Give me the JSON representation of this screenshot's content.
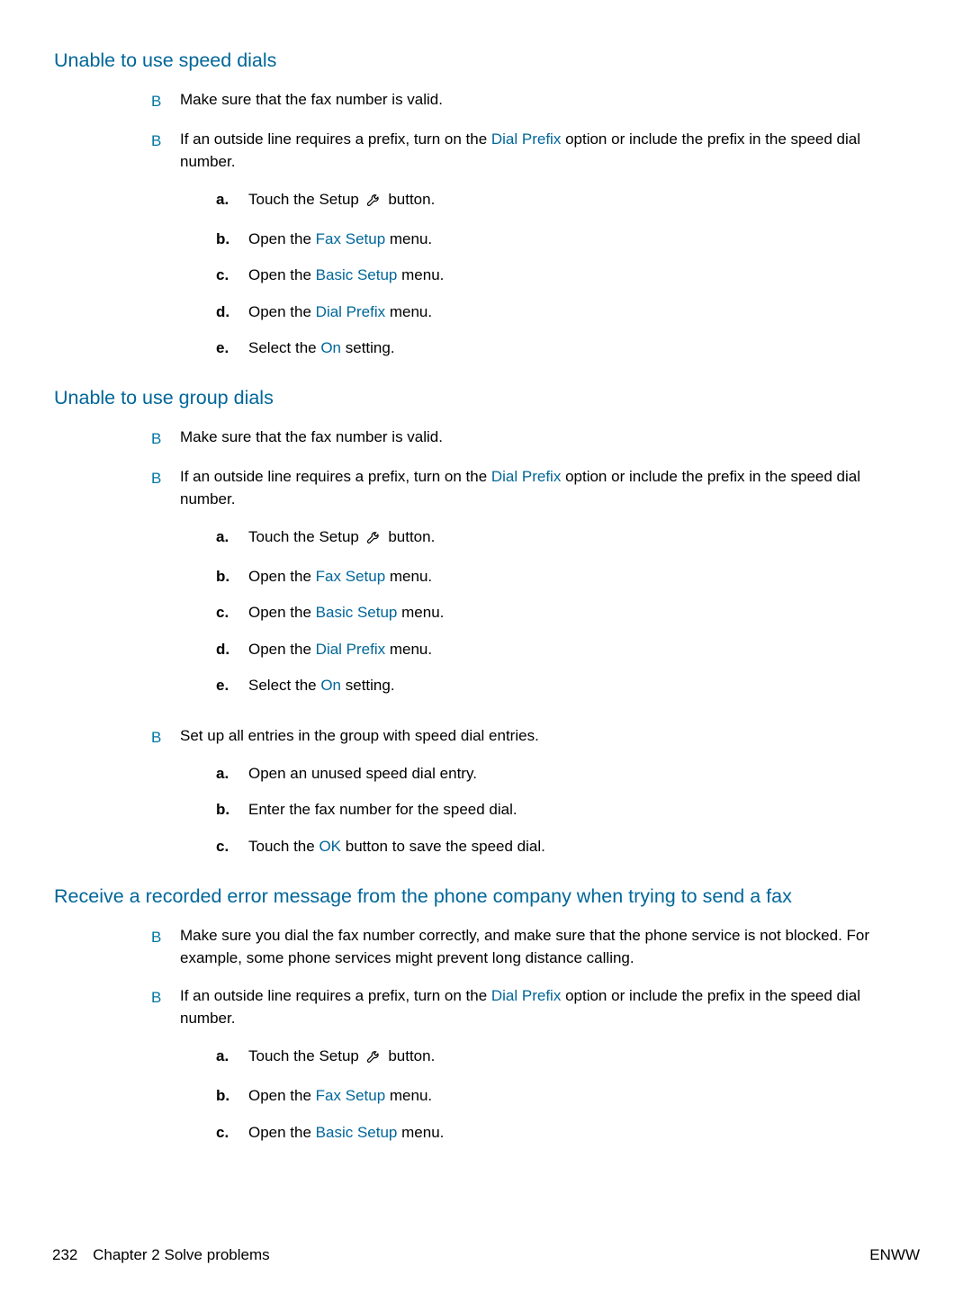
{
  "sections": [
    {
      "title": "Unable to use speed dials",
      "items": [
        {
          "parts": [
            {
              "t": "Make sure that the fax number is valid."
            }
          ]
        },
        {
          "parts": [
            {
              "t": "If an outside line requires a prefix, turn on the "
            },
            {
              "t": "Dial Prefix",
              "link": true
            },
            {
              "t": " option or include the prefix in the speed dial number."
            }
          ],
          "sub": [
            {
              "m": "a.",
              "parts": [
                {
                  "t": "Touch the Setup "
                },
                {
                  "icon": "wrench"
                },
                {
                  "t": " button."
                }
              ]
            },
            {
              "m": "b.",
              "parts": [
                {
                  "t": "Open the "
                },
                {
                  "t": "Fax Setup",
                  "link": true
                },
                {
                  "t": " menu."
                }
              ]
            },
            {
              "m": "c.",
              "parts": [
                {
                  "t": "Open the "
                },
                {
                  "t": "Basic Setup",
                  "link": true
                },
                {
                  "t": " menu."
                }
              ]
            },
            {
              "m": "d.",
              "parts": [
                {
                  "t": "Open the "
                },
                {
                  "t": "Dial Prefix",
                  "link": true
                },
                {
                  "t": " menu."
                }
              ]
            },
            {
              "m": "e.",
              "parts": [
                {
                  "t": "Select the "
                },
                {
                  "t": "On",
                  "link": true
                },
                {
                  "t": " setting."
                }
              ]
            }
          ]
        }
      ]
    },
    {
      "title": "Unable to use group dials",
      "items": [
        {
          "parts": [
            {
              "t": "Make sure that the fax number is valid."
            }
          ]
        },
        {
          "parts": [
            {
              "t": "If an outside line requires a prefix, turn on the "
            },
            {
              "t": "Dial Prefix",
              "link": true
            },
            {
              "t": " option or include the prefix in the speed dial number."
            }
          ],
          "sub": [
            {
              "m": "a.",
              "parts": [
                {
                  "t": "Touch the Setup "
                },
                {
                  "icon": "wrench"
                },
                {
                  "t": " button."
                }
              ]
            },
            {
              "m": "b.",
              "parts": [
                {
                  "t": "Open the "
                },
                {
                  "t": "Fax Setup",
                  "link": true
                },
                {
                  "t": " menu."
                }
              ]
            },
            {
              "m": "c.",
              "parts": [
                {
                  "t": "Open the "
                },
                {
                  "t": "Basic Setup",
                  "link": true
                },
                {
                  "t": " menu."
                }
              ]
            },
            {
              "m": "d.",
              "parts": [
                {
                  "t": "Open the "
                },
                {
                  "t": "Dial Prefix",
                  "link": true
                },
                {
                  "t": " menu."
                }
              ]
            },
            {
              "m": "e.",
              "parts": [
                {
                  "t": "Select the "
                },
                {
                  "t": "On",
                  "link": true
                },
                {
                  "t": " setting."
                }
              ]
            }
          ]
        },
        {
          "parts": [
            {
              "t": "Set up all entries in the group with speed dial entries."
            }
          ],
          "sub": [
            {
              "m": "a.",
              "parts": [
                {
                  "t": "Open an unused speed dial entry."
                }
              ]
            },
            {
              "m": "b.",
              "parts": [
                {
                  "t": "Enter the fax number for the speed dial."
                }
              ]
            },
            {
              "m": "c.",
              "parts": [
                {
                  "t": "Touch the "
                },
                {
                  "t": "OK",
                  "link": true
                },
                {
                  "t": " button to save the speed dial."
                }
              ]
            }
          ]
        }
      ]
    },
    {
      "title": "Receive a recorded error message from the phone company when trying to send a fax",
      "items": [
        {
          "parts": [
            {
              "t": "Make sure you dial the fax number correctly, and make sure that the phone service is not blocked. For example, some phone services might prevent long distance calling."
            }
          ]
        },
        {
          "parts": [
            {
              "t": "If an outside line requires a prefix, turn on the "
            },
            {
              "t": "Dial Prefix",
              "link": true
            },
            {
              "t": " option or include the prefix in the speed dial number."
            }
          ],
          "sub": [
            {
              "m": "a.",
              "parts": [
                {
                  "t": "Touch the Setup "
                },
                {
                  "icon": "wrench"
                },
                {
                  "t": " button."
                }
              ]
            },
            {
              "m": "b.",
              "parts": [
                {
                  "t": "Open the "
                },
                {
                  "t": "Fax Setup",
                  "link": true
                },
                {
                  "t": " menu."
                }
              ]
            },
            {
              "m": "c.",
              "parts": [
                {
                  "t": "Open the "
                },
                {
                  "t": "Basic Setup",
                  "link": true
                },
                {
                  "t": " menu."
                }
              ]
            }
          ]
        }
      ]
    }
  ],
  "footer": {
    "page_number": "232",
    "chapter": "Chapter 2   Solve problems",
    "right": "ENWW"
  },
  "bullet_marker": "В"
}
